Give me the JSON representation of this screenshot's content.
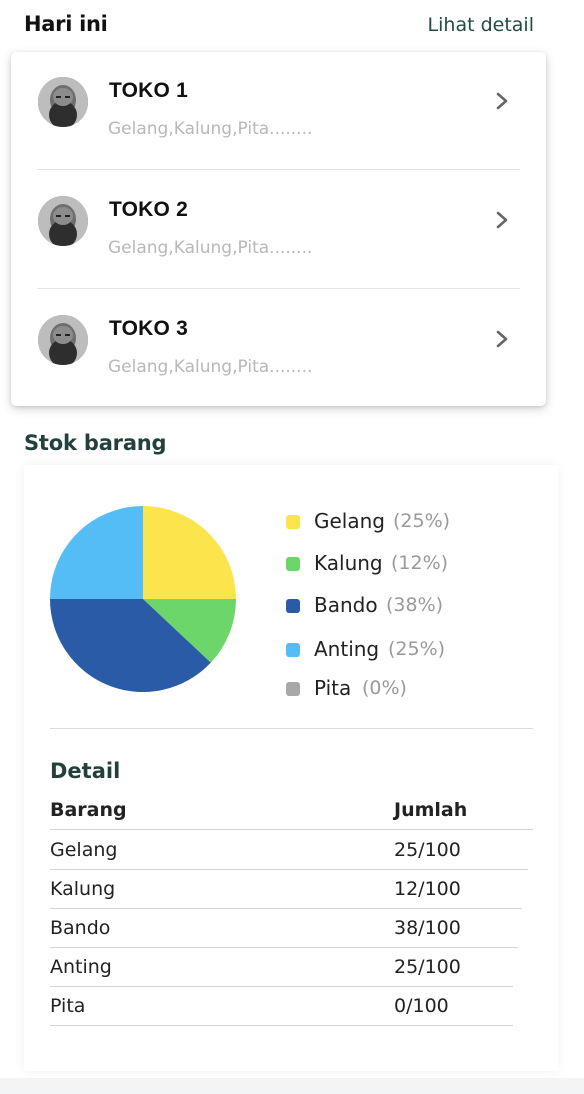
{
  "header": {
    "title": "Hari ini",
    "link": "Lihat detail"
  },
  "stores": [
    {
      "name": "TOKO 1",
      "items": "Gelang,Kalung,Pita........"
    },
    {
      "name": "TOKO 2",
      "items": "Gelang,Kalung,Pita........"
    },
    {
      "name": "TOKO 3",
      "items": "Gelang,Kalung,Pita........"
    }
  ],
  "stock": {
    "title": "Stok barang",
    "legend": [
      {
        "name": "Gelang",
        "pct": "(25%)",
        "color": "#fce54c"
      },
      {
        "name": "Kalung",
        "pct": "(12%)",
        "color": "#6cd66a"
      },
      {
        "name": "Bando",
        "pct": "(38%)",
        "color": "#2a5ba6"
      },
      {
        "name": "Anting",
        "pct": "(25%)",
        "color": "#55bdf5"
      },
      {
        "name": "Pita",
        "pct": "(0%)",
        "color": "#a8a8a8"
      }
    ],
    "detail": {
      "title": "Detail",
      "col_item": "Barang",
      "col_qty": "Jumlah",
      "rows": [
        {
          "item": "Gelang",
          "qty": "25/100"
        },
        {
          "item": "Kalung",
          "qty": "12/100"
        },
        {
          "item": "Bando",
          "qty": "38/100"
        },
        {
          "item": "Anting",
          "qty": "25/100"
        },
        {
          "item": "Pita",
          "qty": "0/100"
        }
      ]
    }
  },
  "chart_data": {
    "type": "pie",
    "title": "",
    "categories": [
      "Gelang",
      "Kalung",
      "Bando",
      "Anting",
      "Pita"
    ],
    "values": [
      25,
      12,
      38,
      25,
      0
    ],
    "colors": [
      "#fce54c",
      "#6cd66a",
      "#2a5ba6",
      "#55bdf5",
      "#a8a8a8"
    ],
    "legend": "right"
  }
}
